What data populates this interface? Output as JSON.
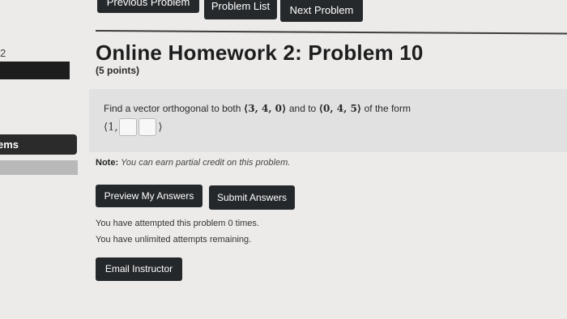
{
  "sidebar": {
    "number": "2",
    "nav_item": "ems"
  },
  "nav": {
    "previous_label": "Previous Problem",
    "list_label": "Problem List",
    "next_label": "Next Problem"
  },
  "header": {
    "title": "Online Homework 2: Problem 10",
    "points": "(5 points)"
  },
  "problem": {
    "text_before": "Find a vector orthogonal to both ",
    "vector1": "⟨3, 4, 0⟩",
    "text_middle": " and to ",
    "vector2": "⟨0, 4, 5⟩",
    "text_after": " of the form",
    "answer_prefix": "⟨1,",
    "answer_suffix": "⟩"
  },
  "note": {
    "label": "Note:",
    "text": "You can earn partial credit on this problem."
  },
  "actions": {
    "preview_label": "Preview My Answers",
    "submit_label": "Submit Answers",
    "email_label": "Email Instructor"
  },
  "status": {
    "attempts": "You have attempted this problem 0 times.",
    "remaining": "You have unlimited attempts remaining."
  }
}
